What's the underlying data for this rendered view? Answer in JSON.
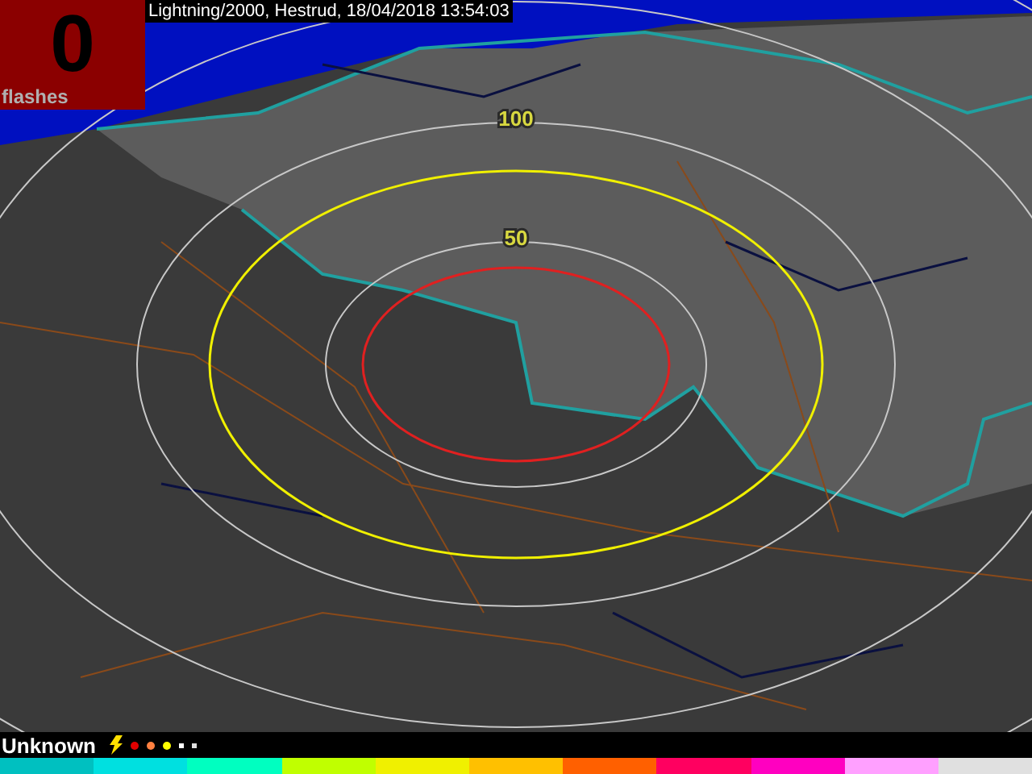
{
  "counter": {
    "value": "0",
    "label": "flashes"
  },
  "title": "Lightning/2000, Hestrud, 18/04/2018 13:54:03",
  "map": {
    "ring_labels": [
      {
        "text": "100"
      },
      {
        "text": "50"
      }
    ]
  },
  "legend": {
    "status": "Unknown",
    "markers": [
      {
        "kind": "bolt",
        "color": "#ffe000"
      },
      {
        "kind": "dot",
        "color": "#e00000"
      },
      {
        "kind": "dot",
        "color": "#ff8040"
      },
      {
        "kind": "dot",
        "color": "#ffff00"
      },
      {
        "kind": "square",
        "color": "#ffffff"
      },
      {
        "kind": "square",
        "color": "#e0e0e0"
      }
    ]
  },
  "color_scale": [
    {
      "color": "#00c0c0"
    },
    {
      "color": "#00e0e0"
    },
    {
      "color": "#00ffc0"
    },
    {
      "color": "#c0ff00"
    },
    {
      "color": "#f0f000"
    },
    {
      "color": "#ffc000"
    },
    {
      "color": "#ff6000"
    },
    {
      "color": "#ff0060"
    },
    {
      "color": "#ff00c0"
    },
    {
      "color": "#ffa0ff"
    },
    {
      "color": "#e0e0e0"
    }
  ]
}
